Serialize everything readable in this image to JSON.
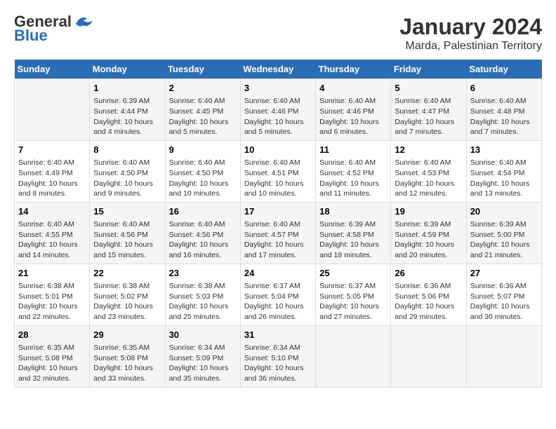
{
  "header": {
    "logo_line1": "General",
    "logo_line2": "Blue",
    "month": "January 2024",
    "location": "Marda, Palestinian Territory"
  },
  "weekdays": [
    "Sunday",
    "Monday",
    "Tuesday",
    "Wednesday",
    "Thursday",
    "Friday",
    "Saturday"
  ],
  "weeks": [
    [
      {
        "day": "",
        "info": ""
      },
      {
        "day": "1",
        "info": "Sunrise: 6:39 AM\nSunset: 4:44 PM\nDaylight: 10 hours\nand 4 minutes."
      },
      {
        "day": "2",
        "info": "Sunrise: 6:40 AM\nSunset: 4:45 PM\nDaylight: 10 hours\nand 5 minutes."
      },
      {
        "day": "3",
        "info": "Sunrise: 6:40 AM\nSunset: 4:46 PM\nDaylight: 10 hours\nand 5 minutes."
      },
      {
        "day": "4",
        "info": "Sunrise: 6:40 AM\nSunset: 4:46 PM\nDaylight: 10 hours\nand 6 minutes."
      },
      {
        "day": "5",
        "info": "Sunrise: 6:40 AM\nSunset: 4:47 PM\nDaylight: 10 hours\nand 7 minutes."
      },
      {
        "day": "6",
        "info": "Sunrise: 6:40 AM\nSunset: 4:48 PM\nDaylight: 10 hours\nand 7 minutes."
      }
    ],
    [
      {
        "day": "7",
        "info": "Sunrise: 6:40 AM\nSunset: 4:49 PM\nDaylight: 10 hours\nand 8 minutes."
      },
      {
        "day": "8",
        "info": "Sunrise: 6:40 AM\nSunset: 4:50 PM\nDaylight: 10 hours\nand 9 minutes."
      },
      {
        "day": "9",
        "info": "Sunrise: 6:40 AM\nSunset: 4:50 PM\nDaylight: 10 hours\nand 10 minutes."
      },
      {
        "day": "10",
        "info": "Sunrise: 6:40 AM\nSunset: 4:51 PM\nDaylight: 10 hours\nand 10 minutes."
      },
      {
        "day": "11",
        "info": "Sunrise: 6:40 AM\nSunset: 4:52 PM\nDaylight: 10 hours\nand 11 minutes."
      },
      {
        "day": "12",
        "info": "Sunrise: 6:40 AM\nSunset: 4:53 PM\nDaylight: 10 hours\nand 12 minutes."
      },
      {
        "day": "13",
        "info": "Sunrise: 6:40 AM\nSunset: 4:54 PM\nDaylight: 10 hours\nand 13 minutes."
      }
    ],
    [
      {
        "day": "14",
        "info": "Sunrise: 6:40 AM\nSunset: 4:55 PM\nDaylight: 10 hours\nand 14 minutes."
      },
      {
        "day": "15",
        "info": "Sunrise: 6:40 AM\nSunset: 4:56 PM\nDaylight: 10 hours\nand 15 minutes."
      },
      {
        "day": "16",
        "info": "Sunrise: 6:40 AM\nSunset: 4:56 PM\nDaylight: 10 hours\nand 16 minutes."
      },
      {
        "day": "17",
        "info": "Sunrise: 6:40 AM\nSunset: 4:57 PM\nDaylight: 10 hours\nand 17 minutes."
      },
      {
        "day": "18",
        "info": "Sunrise: 6:39 AM\nSunset: 4:58 PM\nDaylight: 10 hours\nand 18 minutes."
      },
      {
        "day": "19",
        "info": "Sunrise: 6:39 AM\nSunset: 4:59 PM\nDaylight: 10 hours\nand 20 minutes."
      },
      {
        "day": "20",
        "info": "Sunrise: 6:39 AM\nSunset: 5:00 PM\nDaylight: 10 hours\nand 21 minutes."
      }
    ],
    [
      {
        "day": "21",
        "info": "Sunrise: 6:38 AM\nSunset: 5:01 PM\nDaylight: 10 hours\nand 22 minutes."
      },
      {
        "day": "22",
        "info": "Sunrise: 6:38 AM\nSunset: 5:02 PM\nDaylight: 10 hours\nand 23 minutes."
      },
      {
        "day": "23",
        "info": "Sunrise: 6:38 AM\nSunset: 5:03 PM\nDaylight: 10 hours\nand 25 minutes."
      },
      {
        "day": "24",
        "info": "Sunrise: 6:37 AM\nSunset: 5:04 PM\nDaylight: 10 hours\nand 26 minutes."
      },
      {
        "day": "25",
        "info": "Sunrise: 6:37 AM\nSunset: 5:05 PM\nDaylight: 10 hours\nand 27 minutes."
      },
      {
        "day": "26",
        "info": "Sunrise: 6:36 AM\nSunset: 5:06 PM\nDaylight: 10 hours\nand 29 minutes."
      },
      {
        "day": "27",
        "info": "Sunrise: 6:36 AM\nSunset: 5:07 PM\nDaylight: 10 hours\nand 30 minutes."
      }
    ],
    [
      {
        "day": "28",
        "info": "Sunrise: 6:35 AM\nSunset: 5:08 PM\nDaylight: 10 hours\nand 32 minutes."
      },
      {
        "day": "29",
        "info": "Sunrise: 6:35 AM\nSunset: 5:08 PM\nDaylight: 10 hours\nand 33 minutes."
      },
      {
        "day": "30",
        "info": "Sunrise: 6:34 AM\nSunset: 5:09 PM\nDaylight: 10 hours\nand 35 minutes."
      },
      {
        "day": "31",
        "info": "Sunrise: 6:34 AM\nSunset: 5:10 PM\nDaylight: 10 hours\nand 36 minutes."
      },
      {
        "day": "",
        "info": ""
      },
      {
        "day": "",
        "info": ""
      },
      {
        "day": "",
        "info": ""
      }
    ]
  ]
}
